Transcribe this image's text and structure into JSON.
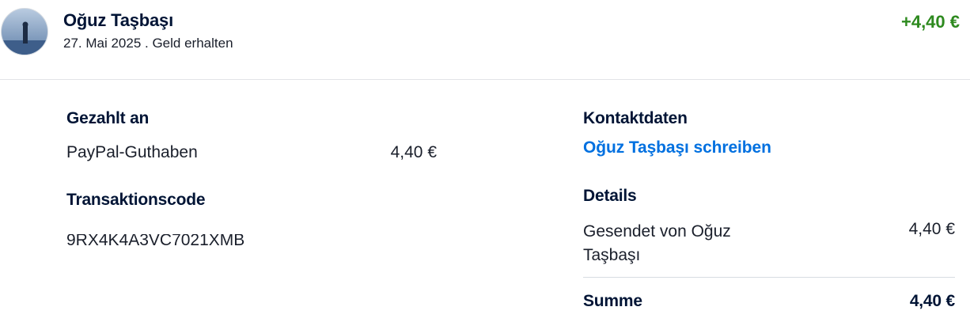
{
  "header": {
    "name": "Oğuz Taşbaşı",
    "subtitle": "27. Mai 2025 . Geld erhalten",
    "amount": "+4,40 €",
    "amount_color": "#2e8a1f"
  },
  "paid_to": {
    "title": "Gezahlt an",
    "method": "PayPal-Guthaben",
    "amount": "4,40 €"
  },
  "transaction": {
    "title": "Transaktionscode",
    "code": "9RX4K4A3VC7021XMB"
  },
  "contact": {
    "title": "Kontaktdaten",
    "link_label": "Oğuz Taşbaşı schreiben",
    "link_color": "#0070e0"
  },
  "details": {
    "title": "Details",
    "sent_from_label": "Gesendet von Oğuz Taşbaşı",
    "sent_from_amount": "4,40 €",
    "total_label": "Summe",
    "total_amount": "4,40 €"
  }
}
